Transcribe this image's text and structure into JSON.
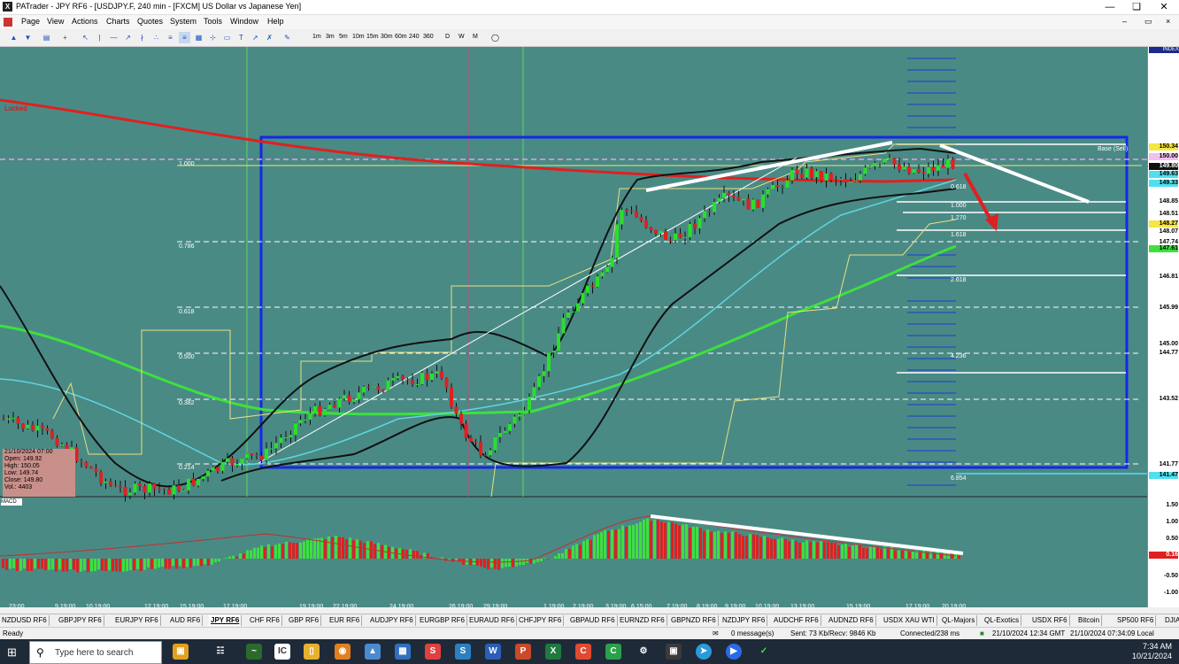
{
  "window": {
    "title": "PATrader - JPY RF6 - [USDJPY.F, 240 min - [FXCM] US Dollar vs Japanese Yen]",
    "app_icon": "X"
  },
  "menu": [
    "Page",
    "View",
    "Actions",
    "Charts",
    "Quotes",
    "System",
    "Tools",
    "Window",
    "Help"
  ],
  "timeframes": [
    "1m",
    "3m",
    "5m",
    "10m",
    "15m",
    "30m",
    "60m",
    "240",
    "360",
    "D",
    "W",
    "M"
  ],
  "chart": {
    "locked_label": "Locked",
    "index_badge": "INDEX",
    "fib_levels": [
      {
        "label": "1.000"
      },
      {
        "label": "0.786"
      },
      {
        "label": "0.618"
      },
      {
        "label": "0.500"
      },
      {
        "label": "0.382"
      },
      {
        "label": "0.214"
      }
    ],
    "right_fib": [
      "0.618",
      "1.000",
      "1.270",
      "1.618",
      "2.618",
      "4.236",
      "6.854"
    ],
    "base_label": "Base (Sell)",
    "macd_label": "MACD",
    "price_labels": [
      "150.34",
      "150.00",
      "149.80",
      "149.63",
      "149.33",
      "148.85",
      "148.51",
      "148.27",
      "148.07",
      "147.74",
      "147.61",
      "146.81",
      "145.99",
      "145.00",
      "144.77",
      "143.52",
      "141.77",
      "141.47"
    ],
    "macd_labels": [
      "1.50",
      "1.00",
      "0.50",
      "0.16",
      "-0.50",
      "-1.00"
    ],
    "info": {
      "date": "21/10/2024 07:00",
      "open": "Open: 149.92",
      "high": "High: 150.05",
      "low": "Low: 149.74",
      "close": "Close: 149.80",
      "vol": "Vol.: 4403"
    },
    "time_labels": [
      "23:00",
      "9 19:00",
      "10 19:00",
      "12 19:00",
      "15 19:00",
      "17 19:00",
      "19 19:00",
      "22 19:00",
      "24 19:00",
      "26 19:00",
      "29 19:00",
      "1 19:00",
      "2 19:00",
      "3 19:00",
      "6 15:00",
      "7 19:00",
      "8 19:00",
      "9 19:00",
      "10 19:00",
      "13 19:00",
      "15 19:00",
      "17 19:00",
      "20 19:00"
    ]
  },
  "tabs": [
    "NZDUSD RF6",
    "GBPJPY RF6",
    "EURJPY RF6",
    "AUD RF6",
    "JPY RF6",
    "CHF RF6",
    "GBP RF6",
    "EUR RF6",
    "AUDJPY RF6",
    "EURGBP RF6",
    "EURAUD RF6",
    "CHFJPY RF6",
    "GBPAUD RF6",
    "EURNZD RF6",
    "GBPNZD RF6",
    "NZDJPY RF6",
    "AUDCHF RF6",
    "AUDNZD RF6",
    "USDX XAU WTI",
    "QL-Majors",
    "QL-Exotics",
    "USDX RF6",
    "Bitcoin",
    "SP500 RF6",
    "DJIA"
  ],
  "active_tab": "JPY RF6",
  "status": {
    "ready": "Ready",
    "messages": "0 message(s)",
    "traffic": "Sent: 73 Kb/Recv: 9846 Kb",
    "connected": "Connected/238 ms",
    "gmt": "21/10/2024 12:34 GMT",
    "local": "21/10/2024 07:34:09 Local"
  },
  "taskbar": {
    "search_placeholder": "Type here to search",
    "time": "7:34 AM",
    "date": "10/21/2024"
  }
}
